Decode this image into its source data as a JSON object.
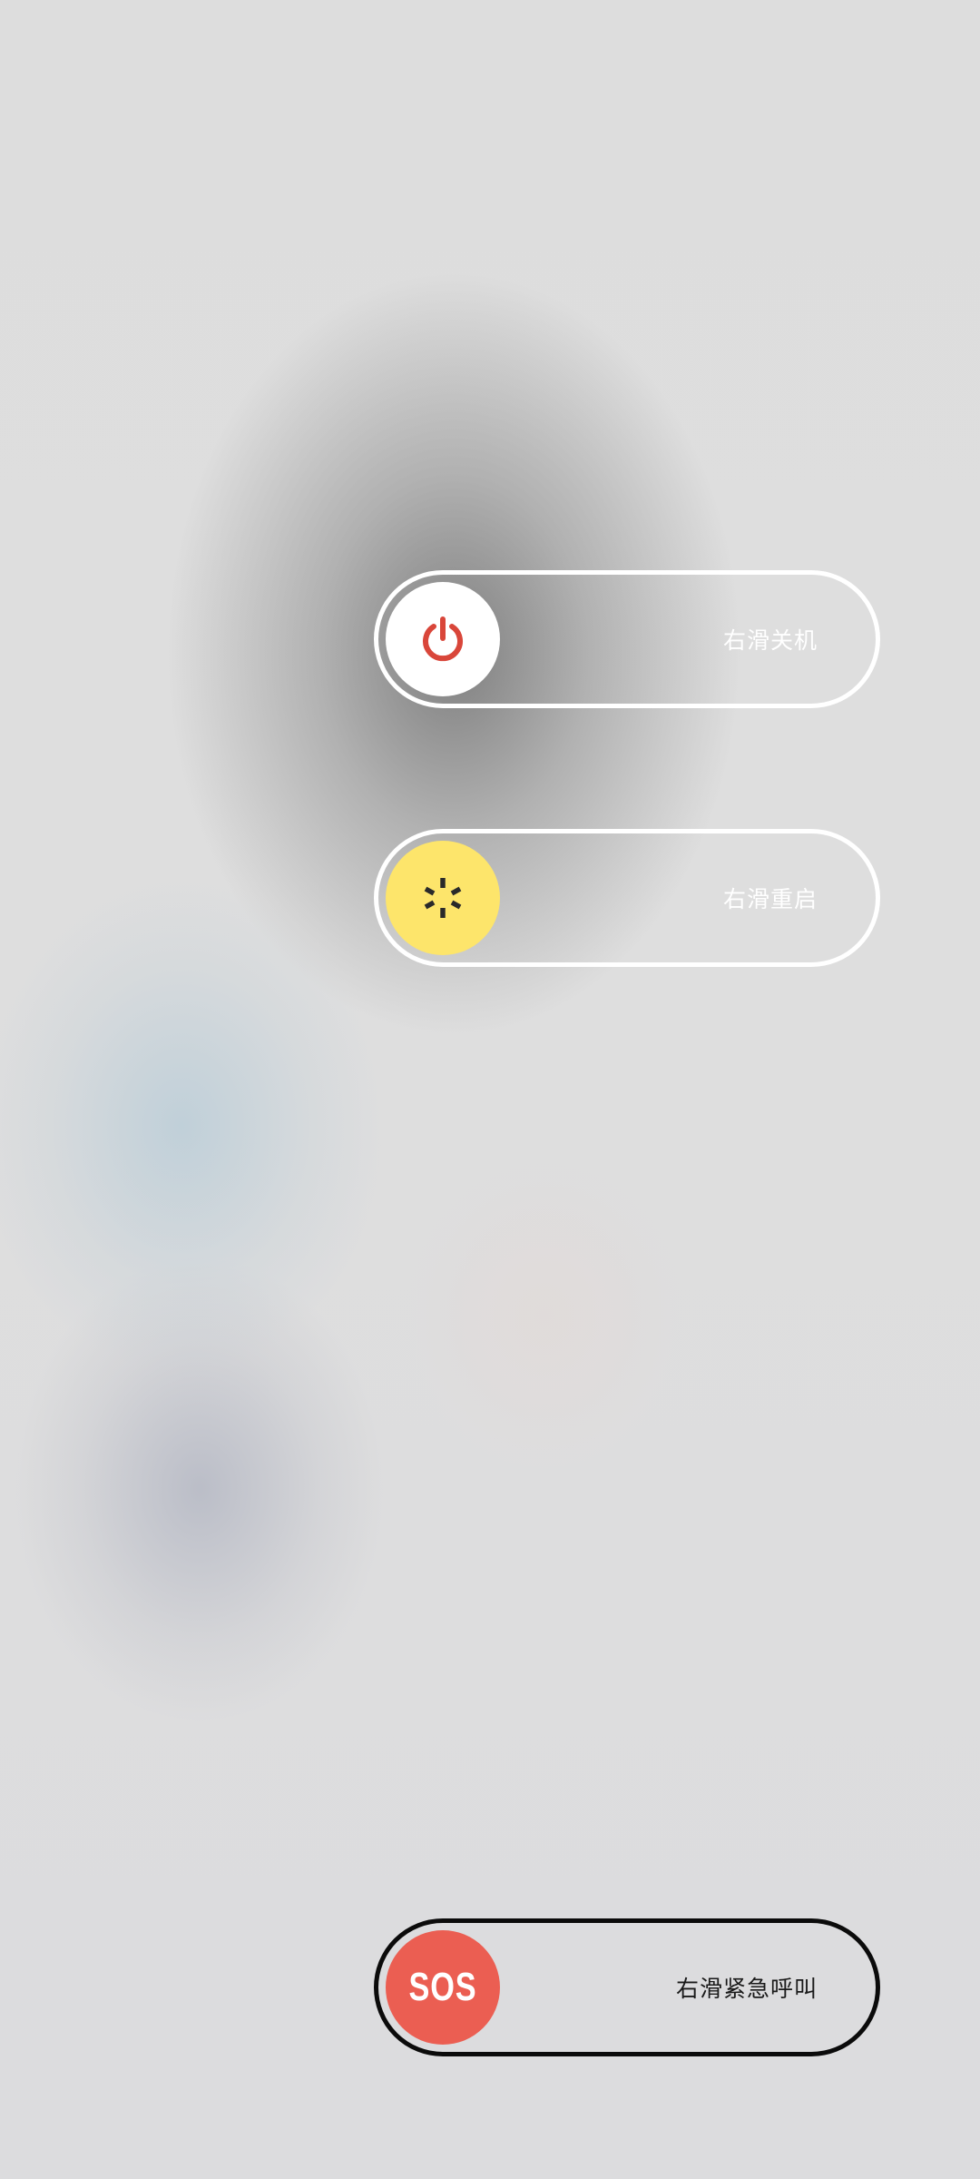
{
  "power_menu": {
    "power_off": {
      "label": "右滑关机",
      "icon": "power-icon",
      "knob_color": "#ffffff",
      "icon_color": "#d9463a"
    },
    "restart": {
      "label": "右滑重启",
      "icon": "restart-icon",
      "knob_color": "#fde56b",
      "icon_color": "#2a2a2a"
    },
    "emergency": {
      "label": "右滑紧急呼叫",
      "icon_text": "SOS",
      "knob_color": "#eb5e52"
    }
  }
}
